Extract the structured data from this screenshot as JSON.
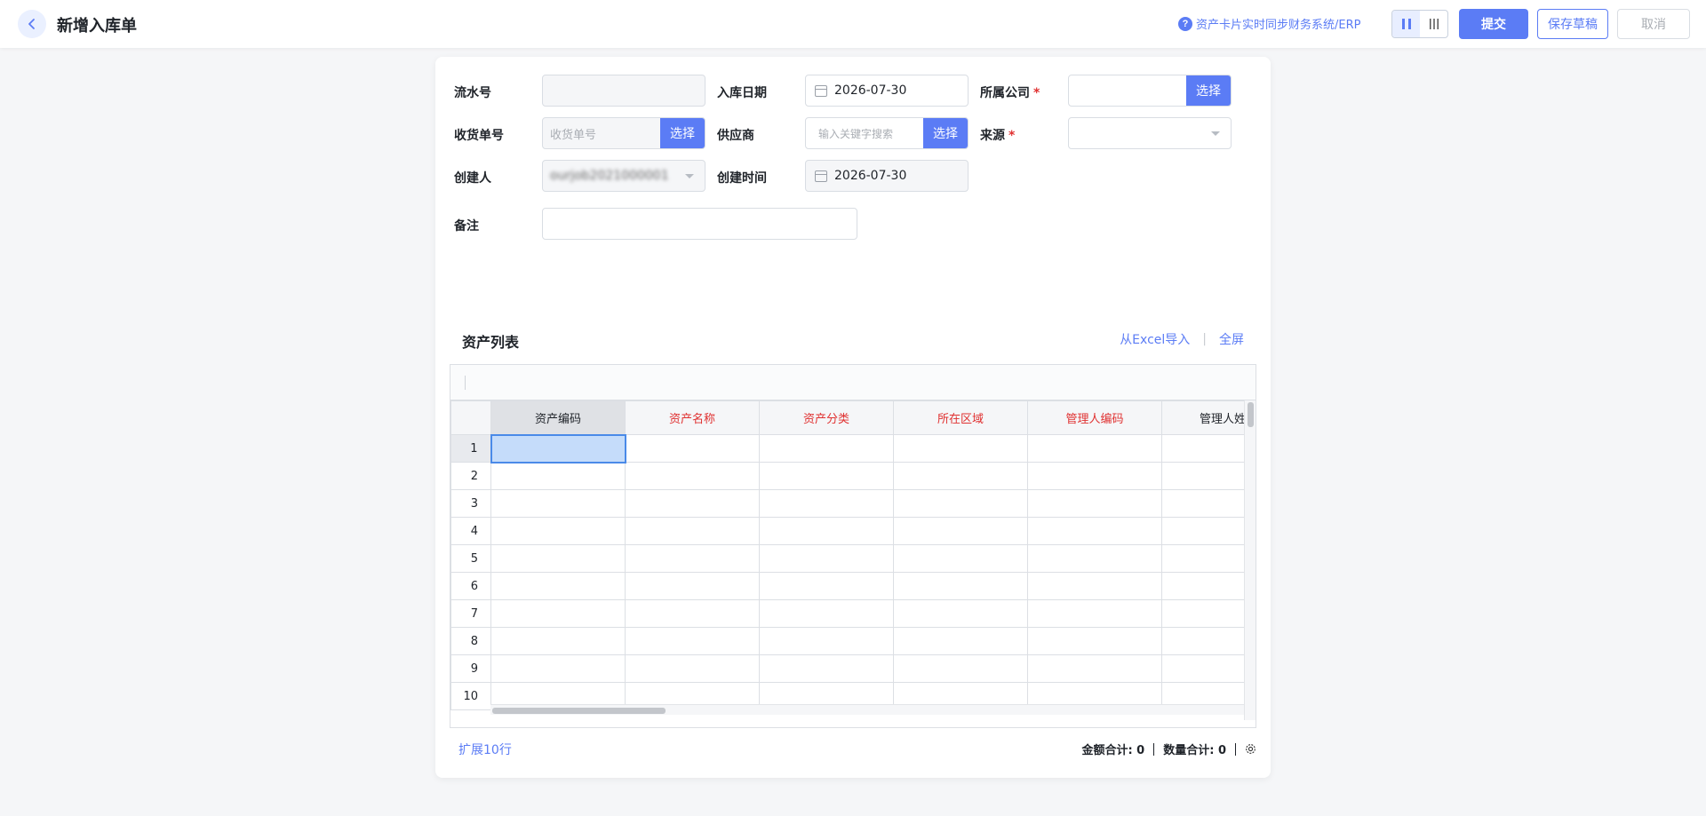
{
  "header": {
    "title": "新增入库单",
    "sync_link": "资产卡片实时同步财务系统/ERP",
    "submit": "提交",
    "save_draft": "保存草稿",
    "cancel": "取消"
  },
  "form": {
    "serial_no": {
      "label": "流水号",
      "value": ""
    },
    "inbound_date": {
      "label": "入库日期",
      "value": "2026-07-30"
    },
    "company": {
      "label": "所属公司",
      "required": "*",
      "value": "",
      "button": "选择"
    },
    "receipt_no": {
      "label": "收货单号",
      "placeholder": "收货单号",
      "button": "选择"
    },
    "supplier": {
      "label": "供应商",
      "placeholder": "输入关键字搜索",
      "button": "选择"
    },
    "source": {
      "label": "来源",
      "required": "*",
      "value": ""
    },
    "creator": {
      "label": "创建人",
      "value": "ourjob2021000001"
    },
    "created_time": {
      "label": "创建时间",
      "value": "2026-07-30"
    },
    "remark": {
      "label": "备注",
      "value": ""
    }
  },
  "asset_list": {
    "title": "资产列表",
    "import_excel": "从Excel导入",
    "link_sep": "|",
    "fullscreen": "全屏",
    "columns": [
      "资产编码",
      "资产名称",
      "资产分类",
      "所在区域",
      "管理人编码",
      "管理人姓"
    ],
    "rows": [
      "1",
      "2",
      "3",
      "4",
      "5",
      "6",
      "7",
      "8",
      "9",
      "10"
    ],
    "expand": "扩展10行",
    "amount_total": "金额合计: 0",
    "qty_total": "数量合计: 0"
  },
  "colors": {
    "primary": "#5b7cf5",
    "required": "#e03131",
    "active_cell": "#c5dcfa"
  }
}
